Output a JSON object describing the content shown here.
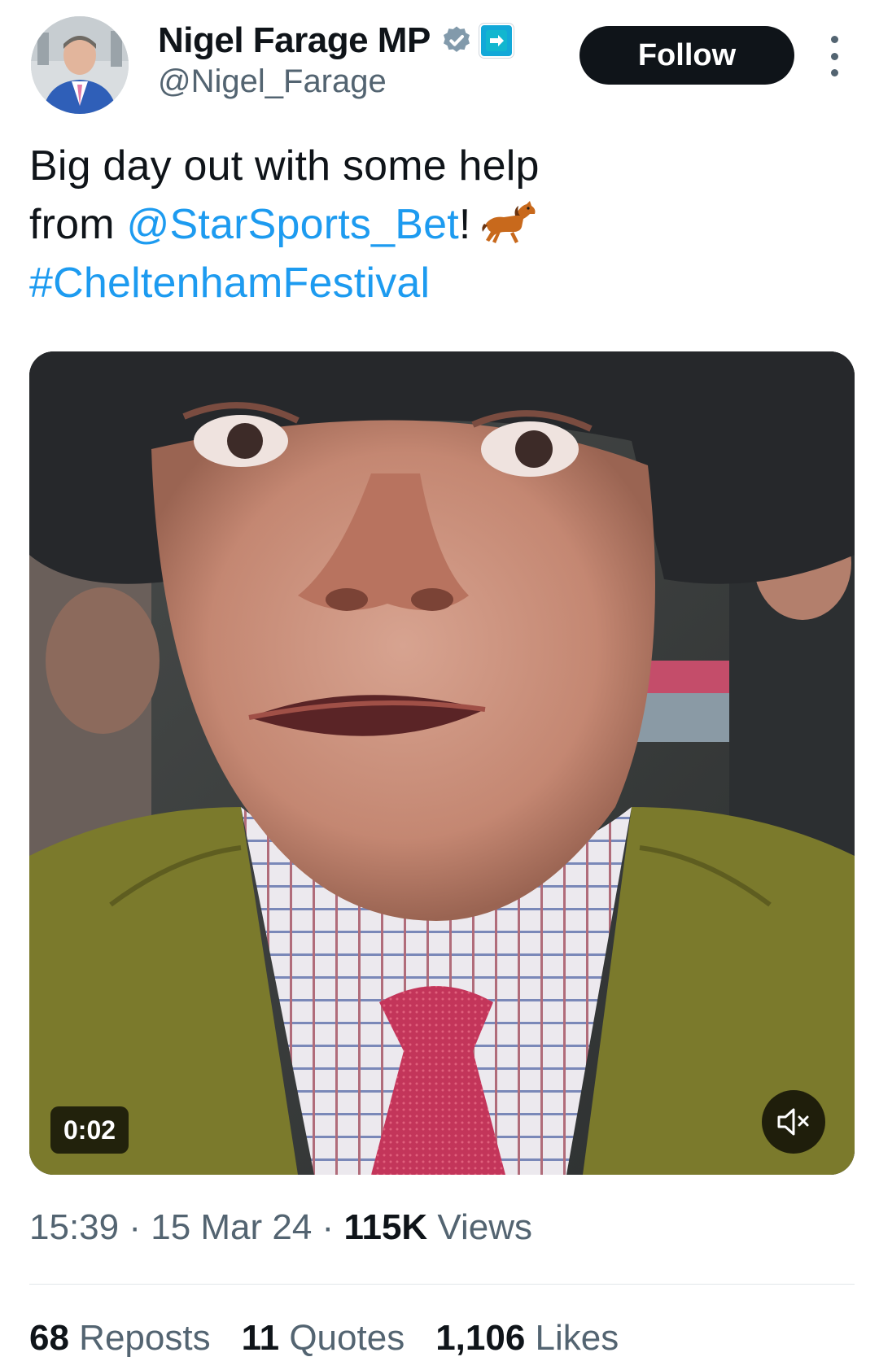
{
  "author": {
    "display_name": "Nigel Farage MP",
    "handle": "@Nigel_Farage",
    "verified_icon": "verified-badge-icon",
    "affiliate_badge": "reform-uk-badge-icon",
    "brand_color": "#1d9bf0"
  },
  "header": {
    "follow_label": "Follow",
    "more_icon": "more-options-icon"
  },
  "tweet": {
    "text_line1": "Big day out with some help",
    "text_from": "from ",
    "mention": "@StarSports_Bet",
    "text_bang": "!",
    "emoji": "horse-racing-icon",
    "hashtag": "#CheltenhamFestival"
  },
  "media": {
    "type": "video",
    "elapsed": "0:02",
    "muted_icon": "speaker-muted-icon"
  },
  "meta": {
    "time": "15:39",
    "sep1": " · ",
    "date": "15 Mar 24",
    "sep2": " · ",
    "views_count": "115K",
    "views_label": " Views"
  },
  "stats": {
    "reposts_count": "68",
    "reposts_label": " Reposts",
    "quotes_count": "11",
    "quotes_label": " Quotes",
    "likes_count": "1,106",
    "likes_label": " Likes"
  }
}
